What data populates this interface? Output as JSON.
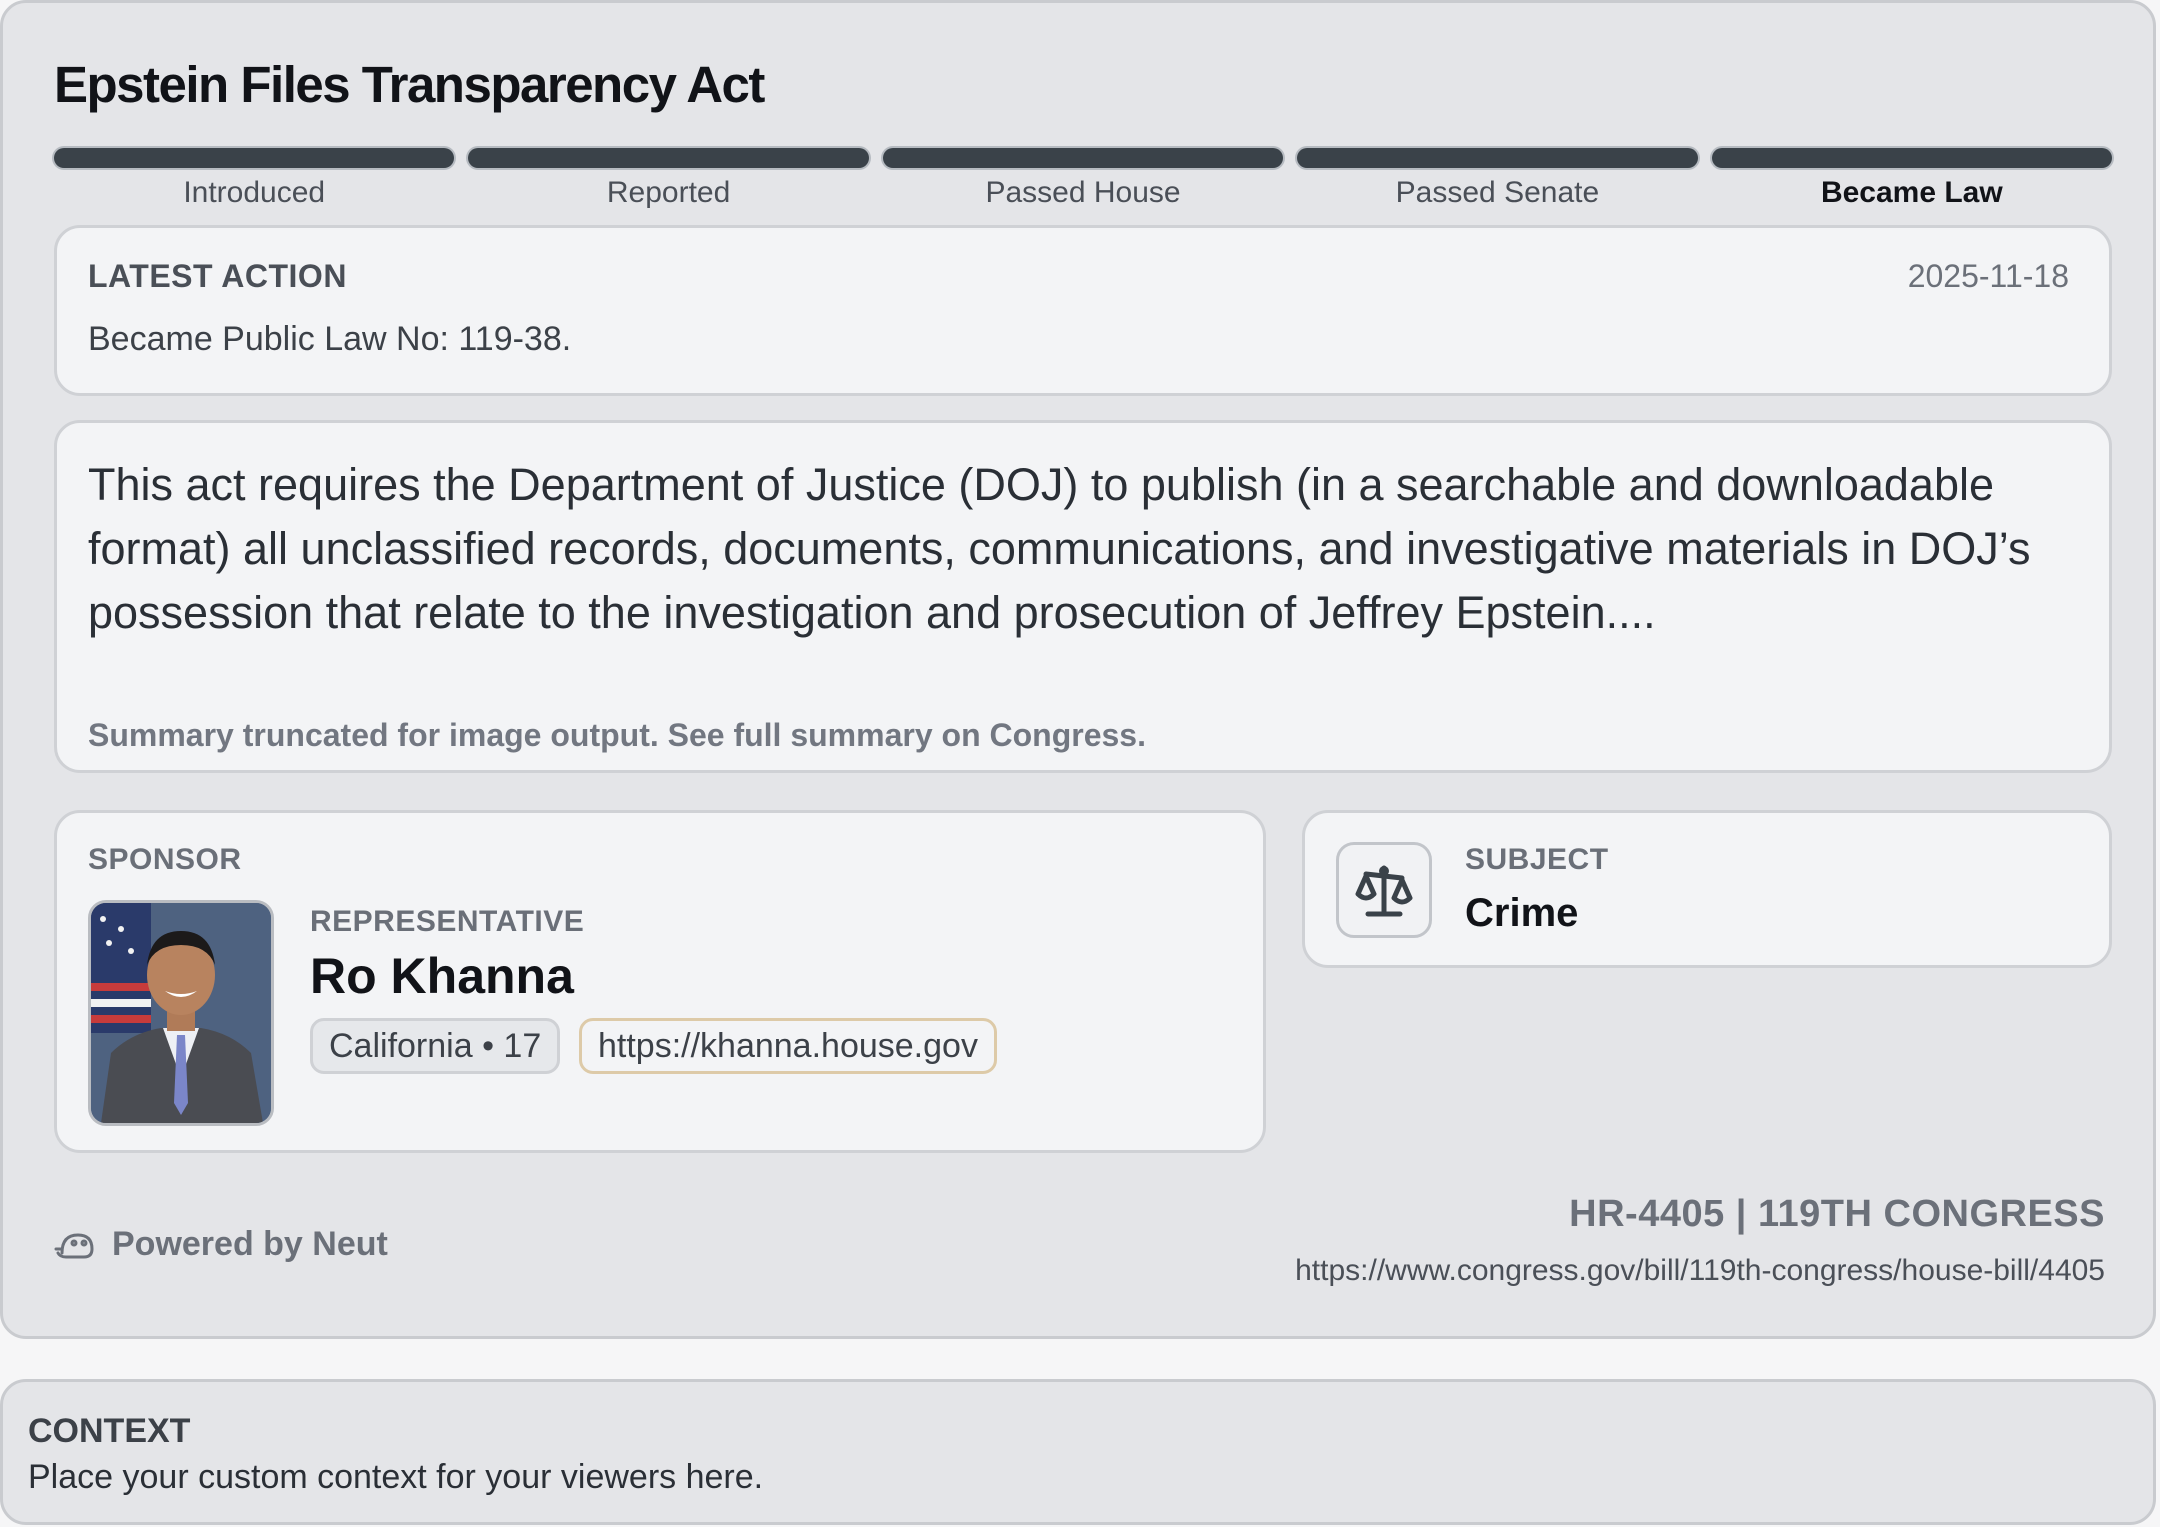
{
  "bill": {
    "title": "Epstein Files Transparency Act",
    "stages": [
      "Introduced",
      "Reported",
      "Passed House",
      "Passed Senate",
      "Became Law"
    ],
    "current_stage": "Became Law"
  },
  "latest_action": {
    "heading": "LATEST ACTION",
    "date": "2025-11-18",
    "text": "Became Public Law No: 119-38."
  },
  "summary": {
    "text": "This act requires the Department of Justice (DOJ) to publish (in a searchable and downloadable format) all unclassified records, documents, communications, and investigative materials in DOJ’s possession that relate to the investigation and prosecution of Jeffrey Epstein....",
    "note": "Summary truncated for image output. See full summary on Congress."
  },
  "sponsor": {
    "heading": "SPONSOR",
    "role": "REPRESENTATIVE",
    "name": "Ro Khanna",
    "district": "California • 17",
    "website": "https://khanna.house.gov"
  },
  "subject": {
    "heading": "SUBJECT",
    "value": "Crime",
    "icon": "scales-icon"
  },
  "footer": {
    "powered_by": "Powered by Neut",
    "bill_id": "HR-4405 | 119TH CONGRESS",
    "url": "https://www.congress.gov/bill/119th-congress/house-bill/4405"
  },
  "context": {
    "heading": "CONTEXT",
    "text": "Place your custom context for your viewers here."
  }
}
